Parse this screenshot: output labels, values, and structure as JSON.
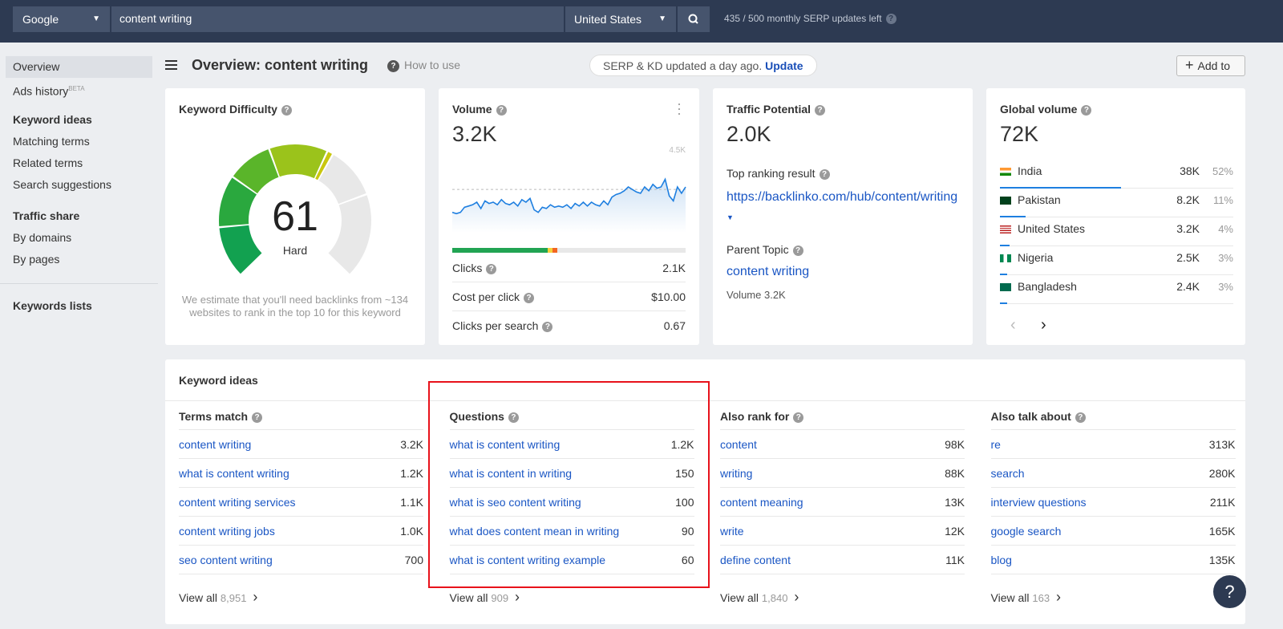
{
  "topbar": {
    "engine": "Google",
    "query": "content writing",
    "country": "United States",
    "updates_left": "435 / 500 monthly SERP updates left"
  },
  "sidebar": {
    "items": [
      {
        "label": "Overview",
        "active": true
      },
      {
        "label": "Ads history",
        "badge": "BETA"
      }
    ],
    "keyword_ideas": {
      "heading": "Keyword ideas",
      "items": [
        "Matching terms",
        "Related terms",
        "Search suggestions"
      ]
    },
    "traffic_share": {
      "heading": "Traffic share",
      "items": [
        "By domains",
        "By pages"
      ]
    },
    "keywords_lists": "Keywords lists"
  },
  "header": {
    "title": "Overview: content writing",
    "how_to_use": "How to use",
    "update_text": "SERP & KD updated a day ago.",
    "update_link": "Update",
    "add_to": "Add to"
  },
  "kd": {
    "title": "Keyword Difficulty",
    "value": "61",
    "score": 61,
    "label": "Hard",
    "note": "We estimate that you'll need backlinks from ~134 websites to rank in the top 10 for this keyword"
  },
  "volume": {
    "title": "Volume",
    "value": "3.2K",
    "chart_max_label": "4.5K",
    "trend": [
      2.3,
      2.25,
      2.3,
      2.5,
      2.55,
      2.6,
      2.7,
      2.45,
      2.75,
      2.65,
      2.7,
      2.6,
      2.8,
      2.65,
      2.6,
      2.7,
      2.55,
      2.8,
      2.7,
      2.85,
      2.4,
      2.3,
      2.5,
      2.45,
      2.6,
      2.5,
      2.55,
      2.5,
      2.6,
      2.45,
      2.65,
      2.55,
      2.7,
      2.55,
      2.7,
      2.6,
      2.55,
      2.75,
      2.6,
      2.9,
      3.0,
      3.05,
      3.15,
      3.3,
      3.2,
      3.1,
      3.05,
      3.3,
      3.15,
      3.4,
      3.25,
      3.3,
      3.6,
      2.95,
      2.75,
      3.3,
      3.05,
      3.3
    ],
    "avg": 3.2,
    "max": 4.5,
    "clicks_split": {
      "organic": 0.41,
      "paid": 0.02,
      "other": 0.02
    },
    "rows": [
      {
        "label": "Clicks",
        "value": "2.1K"
      },
      {
        "label": "Cost per click",
        "value": "$10.00"
      },
      {
        "label": "Clicks per search",
        "value": "0.67"
      }
    ]
  },
  "traffic": {
    "title": "Traffic Potential",
    "value": "2.0K",
    "top_result_label": "Top ranking result",
    "top_result_url": "https://backlinko.com/hub/content/writing",
    "parent_label": "Parent Topic",
    "parent_topic": "content writing",
    "parent_volume": "Volume 3.2K"
  },
  "global": {
    "title": "Global volume",
    "value": "72K",
    "countries": [
      {
        "name": "India",
        "value": "38K",
        "pct": "52%",
        "share": 0.52,
        "flag": "in"
      },
      {
        "name": "Pakistan",
        "value": "8.2K",
        "pct": "11%",
        "share": 0.11,
        "flag": "pk"
      },
      {
        "name": "United States",
        "value": "3.2K",
        "pct": "4%",
        "share": 0.04,
        "flag": "us"
      },
      {
        "name": "Nigeria",
        "value": "2.5K",
        "pct": "3%",
        "share": 0.03,
        "flag": "ng"
      },
      {
        "name": "Bangladesh",
        "value": "2.4K",
        "pct": "3%",
        "share": 0.03,
        "flag": "bd"
      }
    ]
  },
  "ideas": {
    "title": "Keyword ideas",
    "view_all": "View all",
    "columns": [
      {
        "title": "Terms match",
        "count": "8,951",
        "rows": [
          [
            "content writing",
            "3.2K"
          ],
          [
            "what is content writing",
            "1.2K"
          ],
          [
            "content writing services",
            "1.1K"
          ],
          [
            "content writing jobs",
            "1.0K"
          ],
          [
            "seo content writing",
            "700"
          ]
        ]
      },
      {
        "title": "Questions",
        "count": "909",
        "rows": [
          [
            "what is content writing",
            "1.2K"
          ],
          [
            "what is content in writing",
            "150"
          ],
          [
            "what is seo content writing",
            "100"
          ],
          [
            "what does content mean in writing",
            "90"
          ],
          [
            "what is content writing example",
            "60"
          ]
        ]
      },
      {
        "title": "Also rank for",
        "count": "1,840",
        "rows": [
          [
            "content",
            "98K"
          ],
          [
            "writing",
            "88K"
          ],
          [
            "content meaning",
            "13K"
          ],
          [
            "write",
            "12K"
          ],
          [
            "define content",
            "11K"
          ]
        ]
      },
      {
        "title": "Also talk about",
        "count": "163",
        "rows": [
          [
            "re",
            "313K"
          ],
          [
            "search",
            "280K"
          ],
          [
            "interview questions",
            "211K"
          ],
          [
            "google search",
            "165K"
          ],
          [
            "blog",
            "135K"
          ]
        ]
      }
    ]
  },
  "help": "?"
}
